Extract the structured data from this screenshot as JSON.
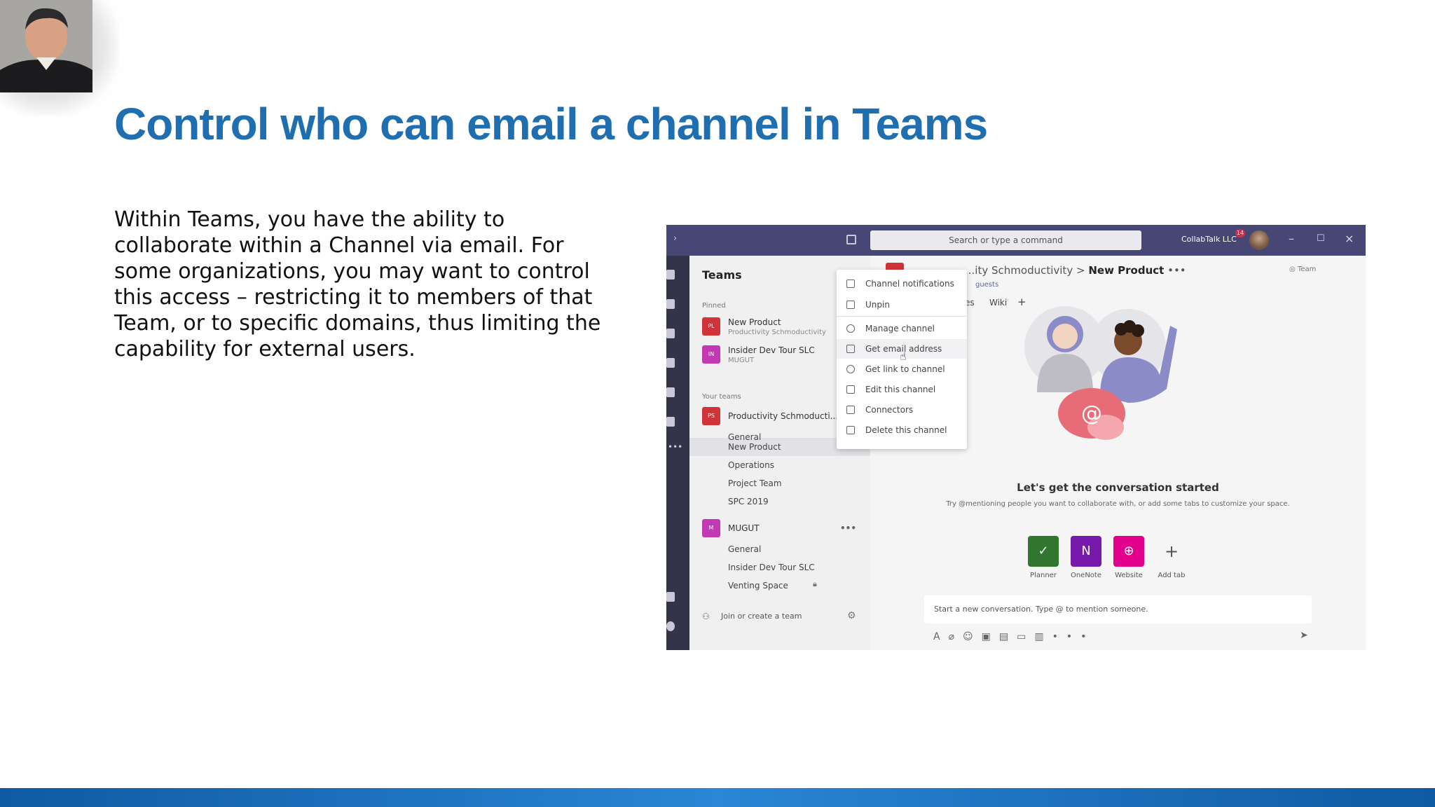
{
  "slide": {
    "title": "Control who can email a channel in Teams",
    "body": "Within Teams, you have the ability to collaborate within a Channel via email. For some organizations, you may want to control this access – restricting it to members of that Team, or to specific domains, thus limiting the capability for external users.",
    "accent_color": "#1f6fb0"
  },
  "teams": {
    "search_placeholder": "Search or type a command",
    "org_name": "CollabTalk LLC",
    "notification_count": "14",
    "panel_title": "Teams",
    "pinned_label": "Pinned",
    "pinned": [
      {
        "initials": "PL",
        "name": "New Product",
        "sub": "Productivity Schmoductivity",
        "color": "#d13438"
      },
      {
        "initials": "IN",
        "name": "Insider Dev Tour SLC",
        "sub": "MUGUT",
        "color": "#c239b3"
      }
    ],
    "your_teams_label": "Your teams",
    "team1": {
      "initials": "PS",
      "name": "Productivity Schmoducti...",
      "color": "#d13438",
      "channels": [
        "General",
        "New Product",
        "Operations",
        "Project Team",
        "SPC 2019"
      ]
    },
    "team2": {
      "initials": "M",
      "name": "MUGUT",
      "color": "#c239b3",
      "channels": [
        "General",
        "Insider Dev Tour SLC",
        "Venting Space"
      ]
    },
    "join_label": "Join or create a team",
    "menu": [
      "Channel notifications",
      "Unpin",
      "Manage channel",
      "Get email address",
      "Get link to channel",
      "Edit this channel",
      "Connectors",
      "Delete this channel"
    ],
    "channel_header_team": "...ity Schmoductivity",
    "channel_header_sep": ">",
    "channel_header_name": "New Product",
    "guests_label": "guests",
    "tabs": [
      "es",
      "Wiki",
      "+"
    ],
    "team_pill": "Team",
    "convo_title": "Let's get the conversation started",
    "convo_sub": "Try @mentioning people you want to collaborate with, or add some tabs to customize your space.",
    "apps": [
      {
        "label": "Planner",
        "color": "#31752f",
        "glyph": "✓"
      },
      {
        "label": "OneNote",
        "color": "#7719aa",
        "glyph": "N"
      },
      {
        "label": "Website",
        "color": "#e3008c",
        "glyph": "⊕"
      },
      {
        "label": "Add tab",
        "color": "#f5f5f5",
        "glyph": "+"
      }
    ],
    "composer_placeholder": "Start a new conversation. Type @ to mention someone."
  }
}
